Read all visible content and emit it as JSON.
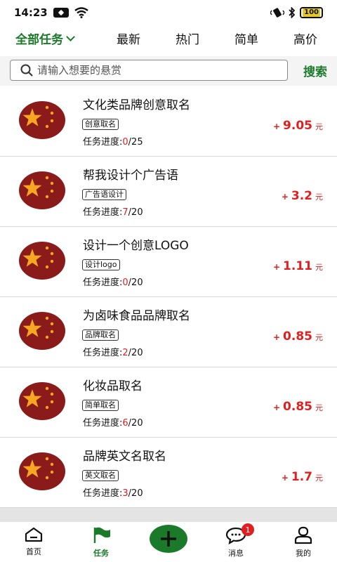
{
  "status_bar": {
    "time": "14:23",
    "battery": "100"
  },
  "tabs": {
    "all": "全部任务",
    "latest": "最新",
    "popular": "热门",
    "simple": "简单",
    "high_price": "高价"
  },
  "search": {
    "placeholder": "请输入想要的悬赏",
    "button": "搜索"
  },
  "progress_label": "任务进度:",
  "currency_unit": "元",
  "tasks": [
    {
      "title": "文化类品牌创意取名",
      "tag": "创意取名",
      "done": "0",
      "total": "/25",
      "reward": "9.05"
    },
    {
      "title": "帮我设计个广告语",
      "tag": "广告语设计",
      "done": "7",
      "total": "/20",
      "reward": "3.2"
    },
    {
      "title": "设计一个创意LOGO",
      "tag": "设计logo",
      "done": "0",
      "total": "/20",
      "reward": "1.11"
    },
    {
      "title": "为卤味食品品牌取名",
      "tag": "品牌取名",
      "done": "2",
      "total": "/20",
      "reward": "0.85"
    },
    {
      "title": "化妆品取名",
      "tag": "简单取名",
      "done": "6",
      "total": "/20",
      "reward": "0.85"
    },
    {
      "title": "品牌英文名取名",
      "tag": "英文取名",
      "done": "3",
      "total": "/20",
      "reward": "1.7"
    }
  ],
  "bottom_nav": {
    "home": "首页",
    "task": "任务",
    "message": "消息",
    "message_badge": "1",
    "me": "我的"
  },
  "colors": {
    "accent": "#1b7a2a",
    "price": "#e02020",
    "flag_red": "#8b1a1a",
    "flag_star": "#f5a623"
  }
}
